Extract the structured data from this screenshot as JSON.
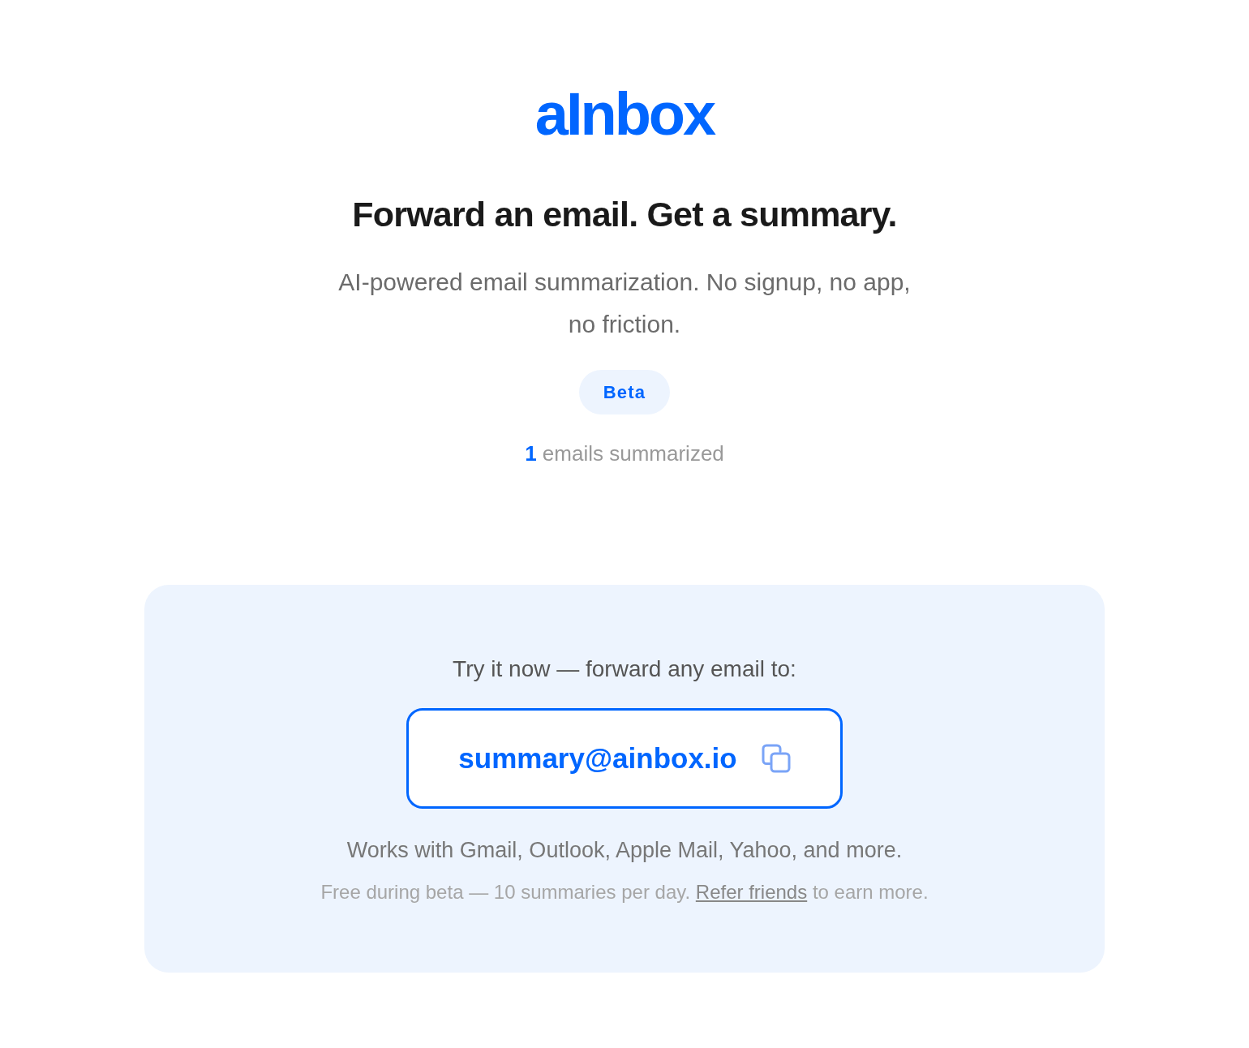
{
  "logo": {
    "text": "aInbox"
  },
  "hero": {
    "heading": "Forward an email. Get a summary.",
    "subtitle": "AI-powered email summarization. No signup, no app, no friction.",
    "badge": "Beta",
    "counter": "**1** emails summarized"
  },
  "try_card": {
    "prompt": "Try it now — forward any email to:",
    "email": "summary@ainbox.io",
    "compatibility": "Works with Gmail, Outlook, Apple Mail, Yahoo, and more.",
    "footnote": {
      "before": "Free during beta — 10 summaries per day.",
      "link": "Refer friends",
      "after": "to earn more."
    }
  }
}
